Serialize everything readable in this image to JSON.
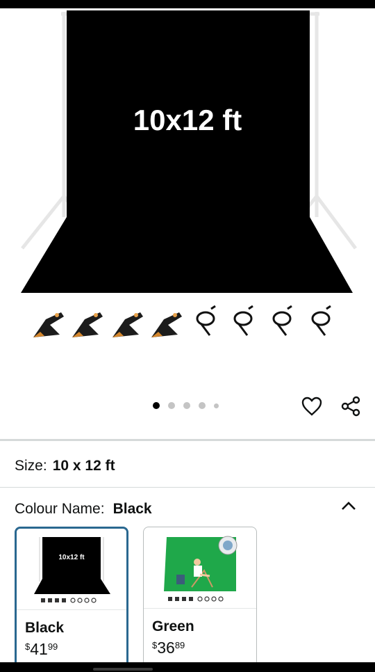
{
  "product": {
    "image_label": "10x12 ft",
    "carousel": {
      "count": 5,
      "active_index": 0
    }
  },
  "actions": {
    "wishlist_icon": "heart-outline-icon",
    "share_icon": "share-icon"
  },
  "size": {
    "label": "Size:",
    "value": "10 x 12 ft"
  },
  "colour": {
    "label": "Colour Name:",
    "value": "Black",
    "toggle_icon": "chevron-up-icon",
    "options": [
      {
        "name": "Black",
        "currency": "$",
        "price_whole": "41",
        "price_fraction": "99",
        "thumb_label": "10x12 ft",
        "selected": true,
        "color": "#000000"
      },
      {
        "name": "Green",
        "currency": "$",
        "price_whole": "36",
        "price_fraction": "89",
        "selected": false,
        "color": "#1fa84a"
      }
    ]
  },
  "colors": {
    "selected_border": "#2a6890",
    "divider": "#d5d9d9"
  }
}
